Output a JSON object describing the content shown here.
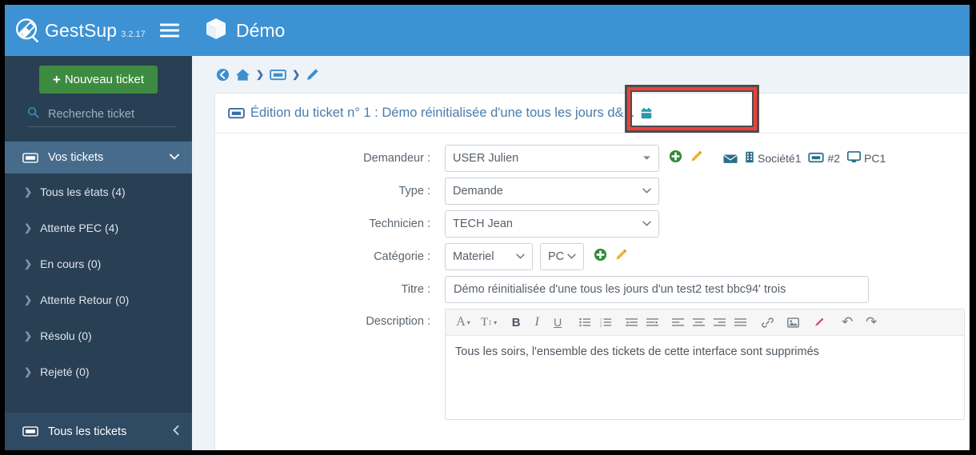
{
  "brand": {
    "name": "GestSup",
    "version": "3.2.17",
    "logo_icon": "gestsup-logo-icon",
    "menu_icon": "hamburger-menu-icon"
  },
  "sidebar": {
    "new_ticket_button": "Nouveau ticket",
    "new_ticket_plus": "+",
    "search": {
      "placeholder": "Recherche ticket",
      "value": "",
      "icon": "search-icon"
    },
    "section": {
      "label": "Vos tickets",
      "icon": "ticket-icon",
      "caret": "⌄"
    },
    "items": [
      {
        "label": "Tous les états (4)",
        "chevron": "❯"
      },
      {
        "label": "Attente PEC (4)",
        "chevron": "❯"
      },
      {
        "label": "En cours (0)",
        "chevron": "❯"
      },
      {
        "label": "Attente Retour (0)",
        "chevron": "❯"
      },
      {
        "label": "Résolu (0)",
        "chevron": "❯"
      },
      {
        "label": "Rejeté (0)",
        "chevron": "❯"
      }
    ],
    "bottom": {
      "label": "Tous les tickets",
      "icon": "ticket-icon",
      "caret": "‹"
    }
  },
  "topbar": {
    "title": "Démo",
    "icon": "cube-icon"
  },
  "breadcrumb": {
    "items": [
      {
        "icon": "back-arrow-icon"
      },
      {
        "icon": "home-icon"
      },
      {
        "separator": "❯"
      },
      {
        "icon": "ticket-icon"
      },
      {
        "separator": "❯"
      },
      {
        "icon": "pencil-icon"
      }
    ]
  },
  "panel": {
    "icon": "ticket-icon",
    "title": "Édition du ticket n° 1 : Démo réinitialisée d'une tous les jours d&...",
    "calendar_icon": "calendar-icon"
  },
  "form": {
    "demandeur": {
      "label": "Demandeur :",
      "value": "USER Julien",
      "add_icon": "add-circle-icon",
      "edit_icon": "pencil-edit-icon",
      "mail_icon": "envelope-icon",
      "company_icon": "building-icon",
      "company": "Société1",
      "ticket_icon": "ticket-icon",
      "ticket_ref": "#2",
      "computer_icon": "monitor-icon",
      "computer": "PC1"
    },
    "type": {
      "label": "Type :",
      "value": "Demande"
    },
    "technicien": {
      "label": "Technicien :",
      "value": "TECH Jean"
    },
    "categorie": {
      "label": "Catégorie :",
      "value1": "Materiel",
      "value2": "PC",
      "add_icon": "add-circle-icon",
      "edit_icon": "pencil-edit-icon"
    },
    "titre": {
      "label": "Titre :",
      "value": "Démo réinitialisée d'une tous les jours d'un test2 test bbc94' trois"
    },
    "description": {
      "label": "Description :",
      "value": "Tous les soirs, l'ensemble des tickets de cette interface sont supprimés",
      "toolbar": [
        {
          "name": "font-color-icon",
          "glyph": "A",
          "caret": "⌄"
        },
        {
          "name": "font-size-icon",
          "glyph": "T↕",
          "caret": "⌄"
        },
        {
          "name": "bold-icon",
          "glyph": "B"
        },
        {
          "name": "italic-icon",
          "glyph": "I"
        },
        {
          "name": "underline-icon",
          "glyph": "U"
        },
        {
          "name": "bullet-list-icon",
          "glyph": "☰"
        },
        {
          "name": "numbered-list-icon",
          "glyph": "☰"
        },
        {
          "name": "outdent-icon",
          "glyph": "☰"
        },
        {
          "name": "indent-icon",
          "glyph": "☰"
        },
        {
          "name": "align-left-icon",
          "glyph": "☰"
        },
        {
          "name": "align-center-icon",
          "glyph": "☰"
        },
        {
          "name": "align-right-icon",
          "glyph": "☰"
        },
        {
          "name": "align-justify-icon",
          "glyph": "☰"
        },
        {
          "name": "link-icon",
          "glyph": "⚭"
        },
        {
          "name": "image-icon",
          "glyph": "▣"
        },
        {
          "name": "marker-icon",
          "glyph": "✒"
        },
        {
          "name": "undo-icon",
          "glyph": "↶"
        },
        {
          "name": "redo-icon",
          "glyph": "↷"
        }
      ]
    }
  },
  "annotation": {
    "highlight_color": "#ef3f3a",
    "outline_color": "#4d4d4d"
  },
  "colors": {
    "header_blue": "#3d92d4",
    "sidebar_dark": "#293f54",
    "sidebar_active": "#476b8a",
    "green": "#3d8b40",
    "page_bg": "#eef3f7",
    "title_blue": "#4b7cab",
    "calendar_teal": "#2c97a8"
  }
}
